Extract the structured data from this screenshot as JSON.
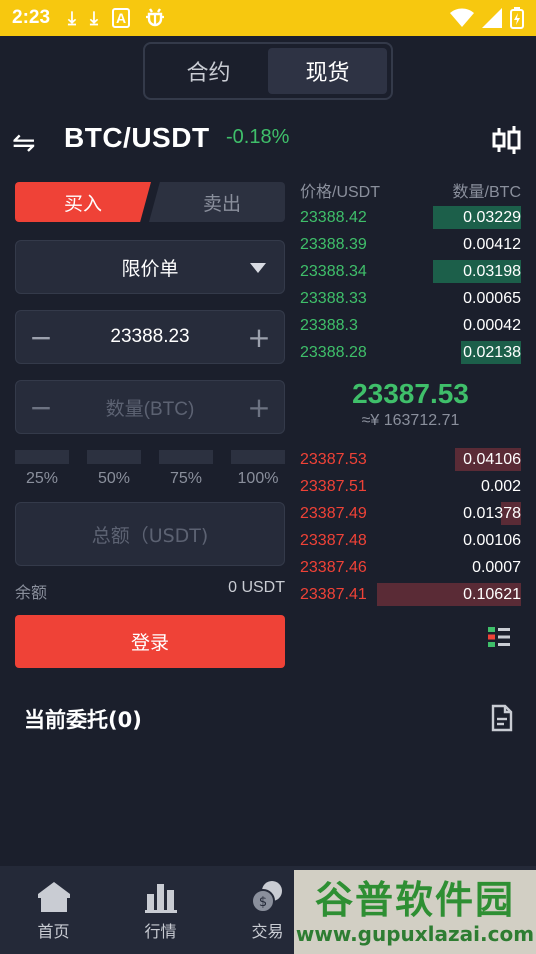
{
  "status_bar": {
    "time": "2:23",
    "icons": [
      "download-icon",
      "download-icon",
      "a-box-icon",
      "bug-icon"
    ],
    "right_icons": [
      "wifi-icon",
      "signal-icon",
      "battery-charging-icon"
    ],
    "background": "#f7c80f"
  },
  "mode_tabs": [
    {
      "label": "合约",
      "active": false
    },
    {
      "label": "现货",
      "active": true
    }
  ],
  "pair": {
    "swap_icon": "⇋",
    "symbol": "BTC/USDT",
    "change": "-0.18%"
  },
  "trade_form": {
    "buy_label": "买入",
    "sell_label": "卖出",
    "order_type": "限价单",
    "price_value": "23388.23",
    "quantity_placeholder": "数量(BTC)",
    "minus": "−",
    "plus": "+",
    "percentages": [
      "25%",
      "50%",
      "75%",
      "100%"
    ],
    "total_placeholder": "总额（USDT)",
    "balance_label": "余额",
    "balance_value": "0 USDT",
    "login_label": "登录"
  },
  "order_book": {
    "price_header": "价格/USDT",
    "qty_header": "数量/BTC",
    "bids": [
      {
        "price": "23388.42",
        "qty": "0.03229",
        "depth": 0.4
      },
      {
        "price": "23388.39",
        "qty": "0.00412",
        "depth": 0.0
      },
      {
        "price": "23388.34",
        "qty": "0.03198",
        "depth": 0.4
      },
      {
        "price": "23388.33",
        "qty": "0.00065",
        "depth": 0.0
      },
      {
        "price": "23388.3",
        "qty": "0.00042",
        "depth": 0.0
      },
      {
        "price": "23388.28",
        "qty": "0.02138",
        "depth": 0.27
      }
    ],
    "last_price": "23387.53",
    "last_price_cny": "≈¥ 163712.71",
    "asks": [
      {
        "price": "23387.53",
        "qty": "0.04106",
        "depth": 0.3
      },
      {
        "price": "23387.51",
        "qty": "0.002",
        "depth": 0.0
      },
      {
        "price": "23387.49",
        "qty": "0.01378",
        "depth": 0.09
      },
      {
        "price": "23387.48",
        "qty": "0.00106",
        "depth": 0.0
      },
      {
        "price": "23387.46",
        "qty": "0.0007",
        "depth": 0.0
      },
      {
        "price": "23387.41",
        "qty": "0.10621",
        "depth": 0.65
      }
    ],
    "bid_color": "#3fbf6a",
    "ask_color": "#ef4237"
  },
  "orders": {
    "title": "当前委托(0)"
  },
  "tab_bar": [
    {
      "label": "首页",
      "icon": "home-icon"
    },
    {
      "label": "行情",
      "icon": "market-chart-icon"
    },
    {
      "label": "交易",
      "icon": "coins-icon"
    }
  ],
  "watermark": {
    "line1": "谷普软件园",
    "line2": "www.gupuxlazai.com"
  }
}
